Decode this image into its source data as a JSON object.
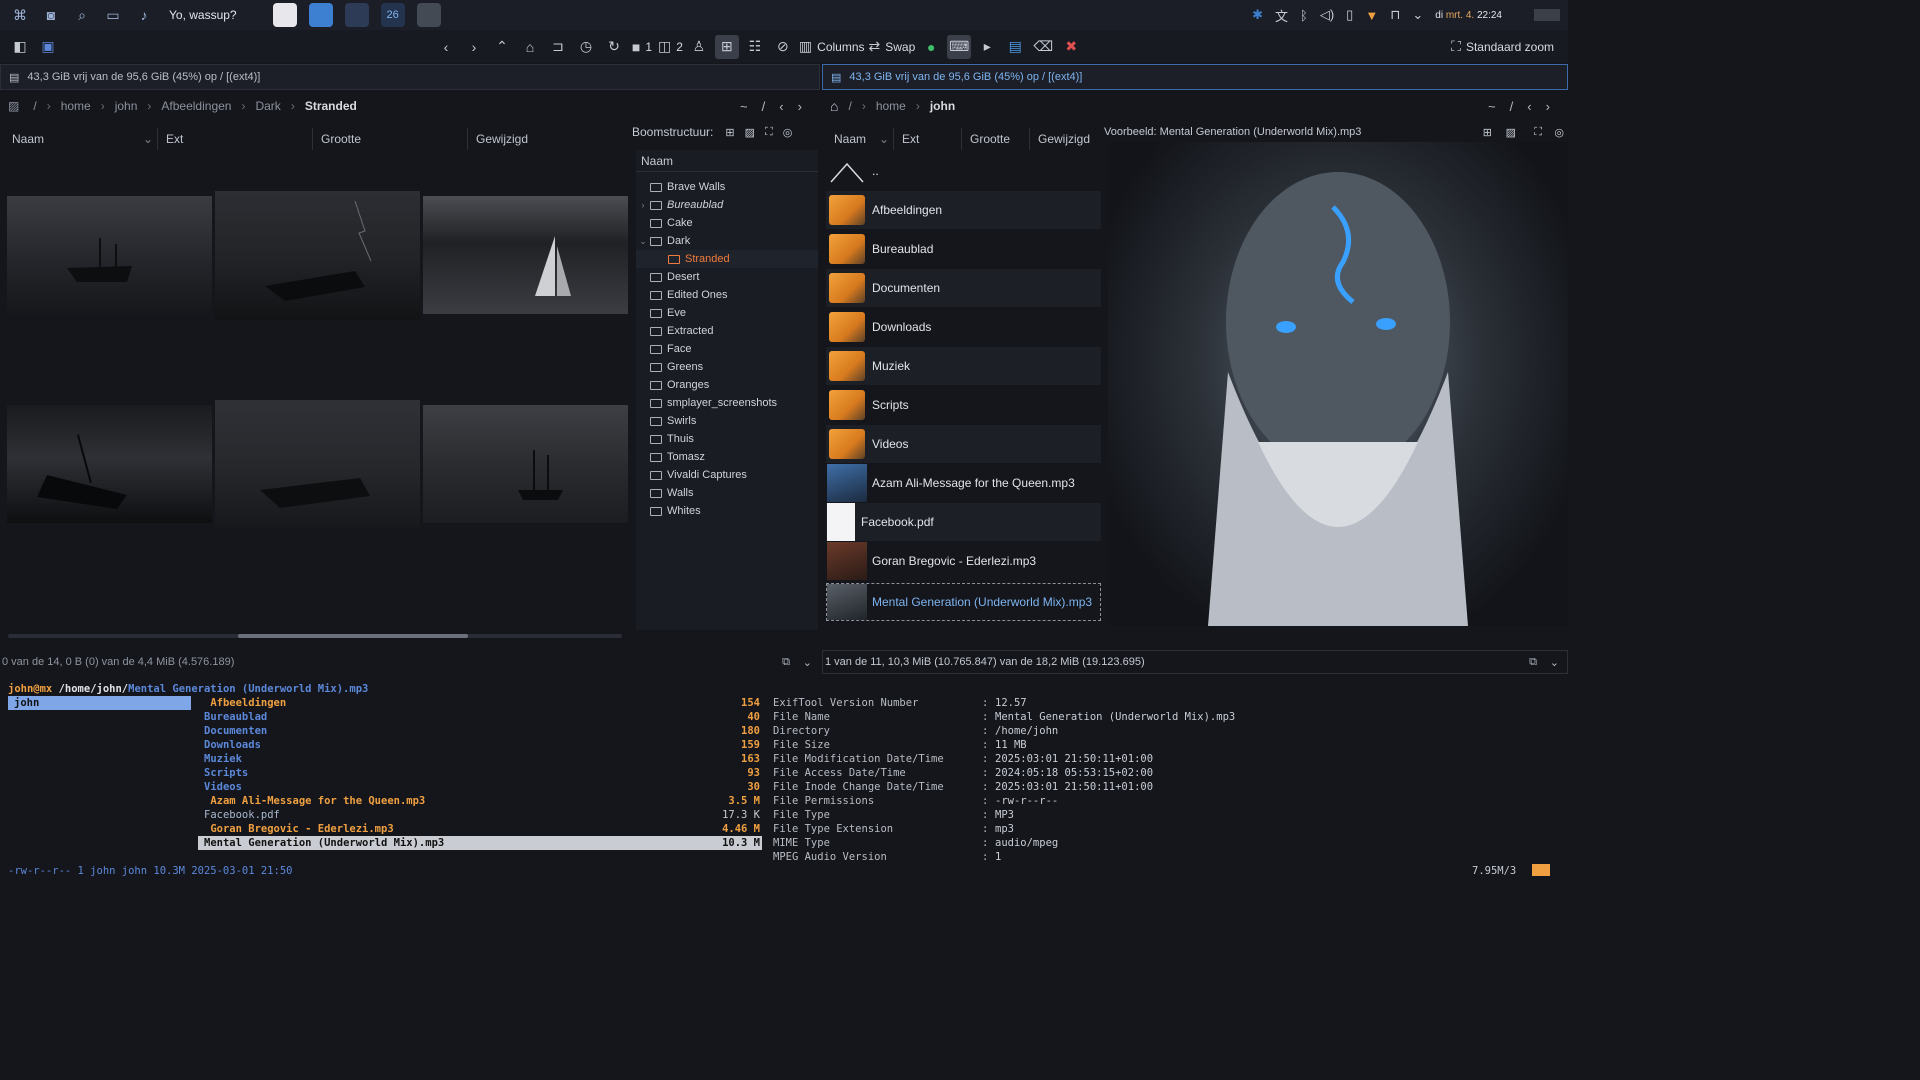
{
  "taskbar": {
    "greeting": "Yo, wassup?",
    "badge": "26",
    "clock": {
      "day": "di",
      "date": "mrt. 4.",
      "time": "22:24"
    }
  },
  "toolbar": {
    "columns_label": "Columns",
    "swap_label": "Swap",
    "pane1": "1",
    "pane2": "2",
    "zoom_label": "Standaard zoom"
  },
  "left": {
    "disk": "43,3 GiB vrij van de 95,6 GiB (45%) op / [(ext4)]",
    "crumbs": [
      "/",
      "home",
      "john",
      "Afbeeldingen",
      "Dark",
      "Stranded"
    ],
    "nav": [
      "~",
      "/",
      "‹",
      "›"
    ],
    "columns": [
      "Naam",
      "Ext",
      "Grootte",
      "Gewijzigd"
    ],
    "status": "0 van de 14, 0 B (0) van de 4,4 MiB (4.576.189)"
  },
  "tree": {
    "label": "Boomstructuur:",
    "header": "Naam",
    "nodes": [
      {
        "name": "Brave Walls",
        "chev": ""
      },
      {
        "name": "Bureaublad",
        "chev": "›"
      },
      {
        "name": "Cake",
        "chev": ""
      },
      {
        "name": "Dark",
        "chev": "⌄"
      },
      {
        "name": "Stranded",
        "chev": ""
      },
      {
        "name": "Desert",
        "chev": ""
      },
      {
        "name": "Edited Ones",
        "chev": ""
      },
      {
        "name": "Eve",
        "chev": ""
      },
      {
        "name": "Extracted",
        "chev": ""
      },
      {
        "name": "Face",
        "chev": ""
      },
      {
        "name": "Greens",
        "chev": ""
      },
      {
        "name": "Oranges",
        "chev": ""
      },
      {
        "name": "smplayer_screenshots",
        "chev": ""
      },
      {
        "name": "Swirls",
        "chev": ""
      },
      {
        "name": "Thuis",
        "chev": ""
      },
      {
        "name": "Tomasz",
        "chev": ""
      },
      {
        "name": "Vivaldi Captures",
        "chev": ""
      },
      {
        "name": "Walls",
        "chev": ""
      },
      {
        "name": "Whites",
        "chev": ""
      }
    ]
  },
  "right": {
    "disk": "43,3 GiB vrij van de 95,6 GiB (45%) op / [(ext4)]",
    "crumbs": [
      "/",
      "home",
      "john"
    ],
    "nav": [
      "~",
      "/",
      "‹",
      "›"
    ],
    "columns": [
      "Naam",
      "Ext",
      "Grootte",
      "Gewijzigd"
    ],
    "preview_title": "Voorbeeld: Mental Generation (Underworld Mix).mp3",
    "parent": "..",
    "items": [
      "Afbeeldingen",
      "Bureaublad",
      "Documenten",
      "Downloads",
      "Muziek",
      "Scripts",
      "Videos",
      "Azam Ali-Message for the Queen.mp3",
      "Facebook.pdf",
      "Goran Bregovic - Ederlezi.mp3",
      "Mental Generation (Underworld Mix).mp3"
    ],
    "status": "1 van de 11, 10,3 MiB (10.765.847) van de 18,2 MiB (19.123.695)"
  },
  "terminal": {
    "prompt_user": "john@mx",
    "prompt_path": " /home/john/",
    "prompt_file": "Mental Generation (Underworld Mix).mp3",
    "sel_dir": "john",
    "listing": [
      {
        "name": " Afbeeldingen",
        "size": "154",
        "kind": "media"
      },
      {
        "name": "Bureaublad",
        "size": "40",
        "kind": "dir"
      },
      {
        "name": "Documenten",
        "size": "180",
        "kind": "dir"
      },
      {
        "name": "Downloads",
        "size": "159",
        "kind": "dir"
      },
      {
        "name": "Muziek",
        "size": "163",
        "kind": "dir"
      },
      {
        "name": "Scripts",
        "size": "93",
        "kind": "dir"
      },
      {
        "name": "Videos",
        "size": "30",
        "kind": "dir"
      },
      {
        "name": " Azam Ali-Message for the Queen.mp3",
        "size": "3.5 M",
        "kind": "media"
      },
      {
        "name": "Facebook.pdf",
        "size": "17.3 K",
        "kind": "file"
      },
      {
        "name": " Goran Bregovic - Ederlezi.mp3",
        "size": "4.46 M",
        "kind": "media"
      },
      {
        "name": "Mental Generation (Underworld Mix).mp3",
        "size": "10.3 M",
        "kind": "sel"
      }
    ],
    "exif": [
      [
        "ExifTool Version Number",
        "12.57"
      ],
      [
        "File Name",
        "Mental Generation (Underworld Mix).mp3"
      ],
      [
        "Directory",
        "/home/john"
      ],
      [
        "File Size",
        "11 MB"
      ],
      [
        "File Modification Date/Time",
        "2025:03:01 21:50:11+01:00"
      ],
      [
        "File Access Date/Time",
        "2024:05:18 05:53:15+02:00"
      ],
      [
        "File Inode Change Date/Time",
        "2025:03:01 21:50:11+01:00"
      ],
      [
        "File Permissions",
        "-rw-r--r--"
      ],
      [
        "File Type",
        "MP3"
      ],
      [
        "File Type Extension",
        "mp3"
      ],
      [
        "MIME Type",
        "audio/mpeg"
      ],
      [
        "MPEG Audio Version",
        "1"
      ]
    ],
    "footer": "-rw-r--r-- 1 john john 10.3M 2025-03-01 21:50",
    "footer_right": "7.95M/3"
  }
}
